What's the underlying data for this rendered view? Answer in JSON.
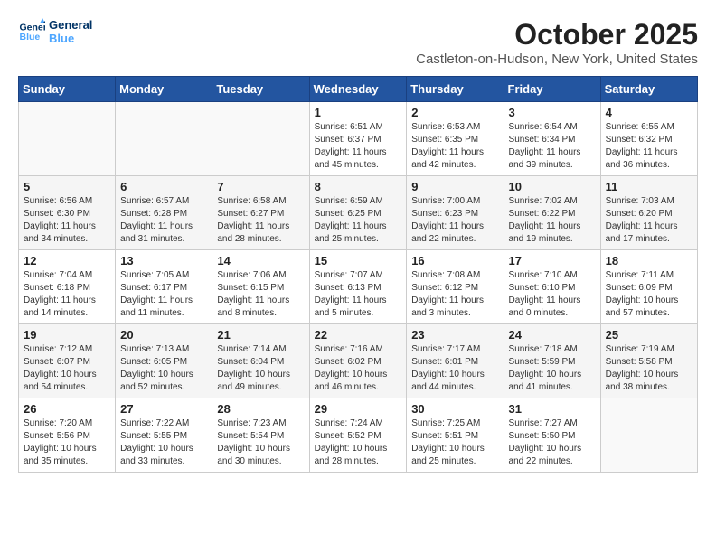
{
  "header": {
    "logo_line1": "General",
    "logo_line2": "Blue",
    "month_title": "October 2025",
    "location": "Castleton-on-Hudson, New York, United States"
  },
  "weekdays": [
    "Sunday",
    "Monday",
    "Tuesday",
    "Wednesday",
    "Thursday",
    "Friday",
    "Saturday"
  ],
  "weeks": [
    [
      {
        "day": "",
        "info": ""
      },
      {
        "day": "",
        "info": ""
      },
      {
        "day": "",
        "info": ""
      },
      {
        "day": "1",
        "info": "Sunrise: 6:51 AM\nSunset: 6:37 PM\nDaylight: 11 hours\nand 45 minutes."
      },
      {
        "day": "2",
        "info": "Sunrise: 6:53 AM\nSunset: 6:35 PM\nDaylight: 11 hours\nand 42 minutes."
      },
      {
        "day": "3",
        "info": "Sunrise: 6:54 AM\nSunset: 6:34 PM\nDaylight: 11 hours\nand 39 minutes."
      },
      {
        "day": "4",
        "info": "Sunrise: 6:55 AM\nSunset: 6:32 PM\nDaylight: 11 hours\nand 36 minutes."
      }
    ],
    [
      {
        "day": "5",
        "info": "Sunrise: 6:56 AM\nSunset: 6:30 PM\nDaylight: 11 hours\nand 34 minutes."
      },
      {
        "day": "6",
        "info": "Sunrise: 6:57 AM\nSunset: 6:28 PM\nDaylight: 11 hours\nand 31 minutes."
      },
      {
        "day": "7",
        "info": "Sunrise: 6:58 AM\nSunset: 6:27 PM\nDaylight: 11 hours\nand 28 minutes."
      },
      {
        "day": "8",
        "info": "Sunrise: 6:59 AM\nSunset: 6:25 PM\nDaylight: 11 hours\nand 25 minutes."
      },
      {
        "day": "9",
        "info": "Sunrise: 7:00 AM\nSunset: 6:23 PM\nDaylight: 11 hours\nand 22 minutes."
      },
      {
        "day": "10",
        "info": "Sunrise: 7:02 AM\nSunset: 6:22 PM\nDaylight: 11 hours\nand 19 minutes."
      },
      {
        "day": "11",
        "info": "Sunrise: 7:03 AM\nSunset: 6:20 PM\nDaylight: 11 hours\nand 17 minutes."
      }
    ],
    [
      {
        "day": "12",
        "info": "Sunrise: 7:04 AM\nSunset: 6:18 PM\nDaylight: 11 hours\nand 14 minutes."
      },
      {
        "day": "13",
        "info": "Sunrise: 7:05 AM\nSunset: 6:17 PM\nDaylight: 11 hours\nand 11 minutes."
      },
      {
        "day": "14",
        "info": "Sunrise: 7:06 AM\nSunset: 6:15 PM\nDaylight: 11 hours\nand 8 minutes."
      },
      {
        "day": "15",
        "info": "Sunrise: 7:07 AM\nSunset: 6:13 PM\nDaylight: 11 hours\nand 5 minutes."
      },
      {
        "day": "16",
        "info": "Sunrise: 7:08 AM\nSunset: 6:12 PM\nDaylight: 11 hours\nand 3 minutes."
      },
      {
        "day": "17",
        "info": "Sunrise: 7:10 AM\nSunset: 6:10 PM\nDaylight: 11 hours\nand 0 minutes."
      },
      {
        "day": "18",
        "info": "Sunrise: 7:11 AM\nSunset: 6:09 PM\nDaylight: 10 hours\nand 57 minutes."
      }
    ],
    [
      {
        "day": "19",
        "info": "Sunrise: 7:12 AM\nSunset: 6:07 PM\nDaylight: 10 hours\nand 54 minutes."
      },
      {
        "day": "20",
        "info": "Sunrise: 7:13 AM\nSunset: 6:05 PM\nDaylight: 10 hours\nand 52 minutes."
      },
      {
        "day": "21",
        "info": "Sunrise: 7:14 AM\nSunset: 6:04 PM\nDaylight: 10 hours\nand 49 minutes."
      },
      {
        "day": "22",
        "info": "Sunrise: 7:16 AM\nSunset: 6:02 PM\nDaylight: 10 hours\nand 46 minutes."
      },
      {
        "day": "23",
        "info": "Sunrise: 7:17 AM\nSunset: 6:01 PM\nDaylight: 10 hours\nand 44 minutes."
      },
      {
        "day": "24",
        "info": "Sunrise: 7:18 AM\nSunset: 5:59 PM\nDaylight: 10 hours\nand 41 minutes."
      },
      {
        "day": "25",
        "info": "Sunrise: 7:19 AM\nSunset: 5:58 PM\nDaylight: 10 hours\nand 38 minutes."
      }
    ],
    [
      {
        "day": "26",
        "info": "Sunrise: 7:20 AM\nSunset: 5:56 PM\nDaylight: 10 hours\nand 35 minutes."
      },
      {
        "day": "27",
        "info": "Sunrise: 7:22 AM\nSunset: 5:55 PM\nDaylight: 10 hours\nand 33 minutes."
      },
      {
        "day": "28",
        "info": "Sunrise: 7:23 AM\nSunset: 5:54 PM\nDaylight: 10 hours\nand 30 minutes."
      },
      {
        "day": "29",
        "info": "Sunrise: 7:24 AM\nSunset: 5:52 PM\nDaylight: 10 hours\nand 28 minutes."
      },
      {
        "day": "30",
        "info": "Sunrise: 7:25 AM\nSunset: 5:51 PM\nDaylight: 10 hours\nand 25 minutes."
      },
      {
        "day": "31",
        "info": "Sunrise: 7:27 AM\nSunset: 5:50 PM\nDaylight: 10 hours\nand 22 minutes."
      },
      {
        "day": "",
        "info": ""
      }
    ]
  ]
}
